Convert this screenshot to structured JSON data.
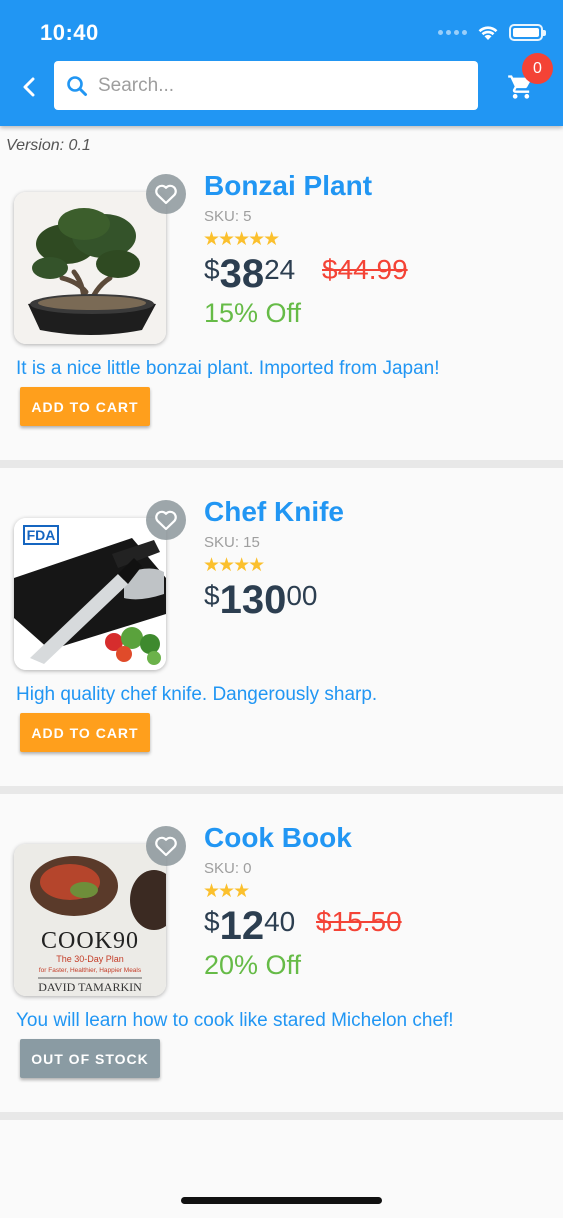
{
  "status": {
    "time": "10:40"
  },
  "search": {
    "placeholder": "Search..."
  },
  "cart": {
    "count": "0"
  },
  "version": "Version: 0.1",
  "products": [
    {
      "title": "Bonzai Plant",
      "sku": "SKU: 5",
      "stars": "★★★★★",
      "rating": 5,
      "price_symbol": "$",
      "price_int": "38",
      "price_dec": "24",
      "old_price": "$44.99",
      "discount": "15% Off",
      "description": "It is a nice little bonzai plant. Imported from Japan!",
      "button": "ADD TO CART"
    },
    {
      "title": "Chef Knife",
      "sku": "SKU: 15",
      "stars": "★★★★",
      "rating": 4,
      "price_symbol": "$",
      "price_int": "130",
      "price_dec": "00",
      "description": "High quality chef knife. Dangerously sharp.",
      "button": "ADD TO CART",
      "image_badge": "FDA"
    },
    {
      "title": "Cook Book",
      "sku": "SKU: 0",
      "stars": "★★★",
      "rating": 3,
      "price_symbol": "$",
      "price_int": "12",
      "price_dec": "40",
      "old_price": "$15.50",
      "discount": "20% Off",
      "description": "You will learn how to cook like stared Michelon chef!",
      "button": "OUT OF STOCK",
      "book": {
        "title": "COOK90",
        "subtitle": "The 30-Day Plan",
        "tagline": "for Faster, Healthier, Happier Meals",
        "author": "DAVID TAMARKIN"
      }
    }
  ],
  "colors": {
    "primary": "#2196f3",
    "accent": "#ff9f1c",
    "danger": "#f44336",
    "success": "#66bb47",
    "disabled": "#8a9ba3"
  }
}
